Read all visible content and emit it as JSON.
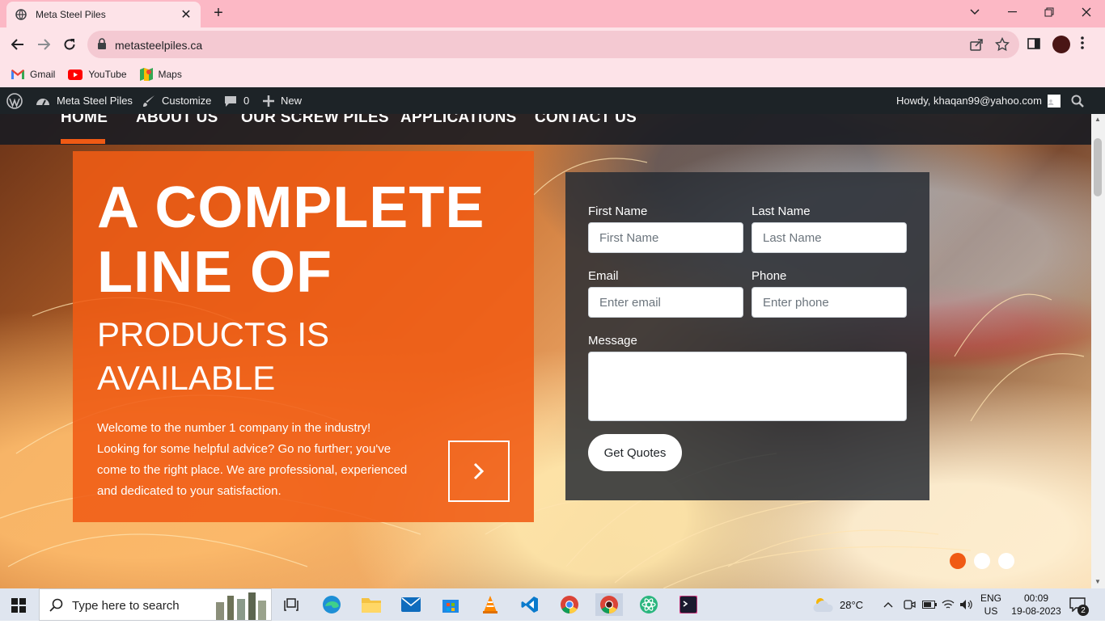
{
  "browser": {
    "tab_title": "Meta Steel Piles",
    "url": "metasteelpiles.ca",
    "bookmarks": [
      {
        "label": "Gmail",
        "icon": "gmail-icon"
      },
      {
        "label": "YouTube",
        "icon": "youtube-icon"
      },
      {
        "label": "Maps",
        "icon": "maps-icon"
      }
    ]
  },
  "wp_admin": {
    "site_name": "Meta Steel Piles",
    "customize": "Customize",
    "comments_count": "0",
    "new": "New",
    "howdy": "Howdy, khaqan99@yahoo.com"
  },
  "nav": {
    "items": [
      "HOME",
      "ABOUT US",
      "OUR SCREW PILES",
      "APPLICATIONS",
      "CONTACT US"
    ],
    "active": "HOME",
    "accent_color": "#f05a14"
  },
  "hero": {
    "headline_line1": "A COMPLETE",
    "headline_line2": "LINE OF",
    "subheadline_line1": "PRODUCTS IS",
    "subheadline_line2": "AVAILABLE",
    "body": "Welcome to the number 1 company in the industry! Looking for some helpful advice? Go no further; you've come to the right place. We are professional, experienced and dedicated to your satisfaction."
  },
  "form": {
    "first_name_label": "First Name",
    "first_name_placeholder": "First Name",
    "last_name_label": "Last Name",
    "last_name_placeholder": "Last Name",
    "email_label": "Email",
    "email_placeholder": "Enter email",
    "phone_label": "Phone",
    "phone_placeholder": "Enter phone",
    "message_label": "Message",
    "submit": "Get Quotes"
  },
  "slider": {
    "dots": 3,
    "active_index": 0
  },
  "taskbar": {
    "search_placeholder": "Type here to search",
    "weather": "28°C",
    "language": "ENG",
    "region": "US",
    "time": "00:09",
    "date": "19-08-2023",
    "notification_count": "2"
  }
}
